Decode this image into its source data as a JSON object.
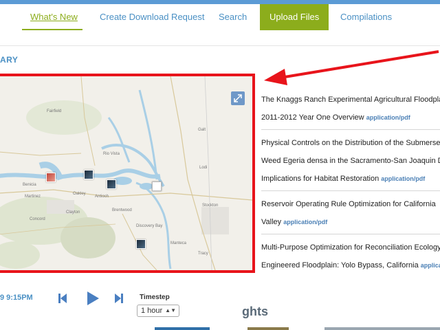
{
  "nav": {
    "whats_new": "What's New",
    "create_download": "Create Download Request",
    "search": "Search",
    "upload_files": "Upload Files",
    "compilations": "Compilations"
  },
  "section": {
    "label": "ARY"
  },
  "map": {
    "cities": [
      "Fairfield",
      "Rio Vista",
      "Benicia",
      "Martinez",
      "Antioch",
      "Stockton",
      "Lodi",
      "Galt",
      "Oakley",
      "Brentwood",
      "Clayton",
      "Concord",
      "Tracy",
      "Manteca",
      "Discovery Bay"
    ],
    "markers": [
      "dark-marker",
      "dark-marker",
      "red-marker",
      "document-marker",
      "dark-marker"
    ]
  },
  "publications": [
    {
      "lines": [
        "The Knaggs Ranch Experimental Agricultural Floodplain",
        "2011-2012 Year One Overview"
      ],
      "mime": "application/pdf"
    },
    {
      "lines": [
        "Physical Controls on the Distribution of the Submersed",
        "Weed Egeria densa in the Sacramento-San Joaquin Delta",
        "Implications for Habitat Restoration"
      ],
      "mime": "application/pdf"
    },
    {
      "lines": [
        "Reservoir Operating Rule Optimization for California",
        "Valley"
      ],
      "mime": "application/pdf"
    },
    {
      "lines": [
        "Multi-Purpose Optimization for Reconciliation Ecology",
        "Engineered Floodplain: Yolo Bypass, California"
      ],
      "mime": "application/pdf"
    }
  ],
  "playback": {
    "time": "9 9:15PM",
    "timestep_label": "Timestep",
    "timestep_value": "1 hour"
  },
  "highlights": {
    "title": "ghts"
  },
  "colors": {
    "accent_green": "#8cad1c",
    "link_blue": "#4a90c4",
    "annotation_red": "#e8141b"
  }
}
